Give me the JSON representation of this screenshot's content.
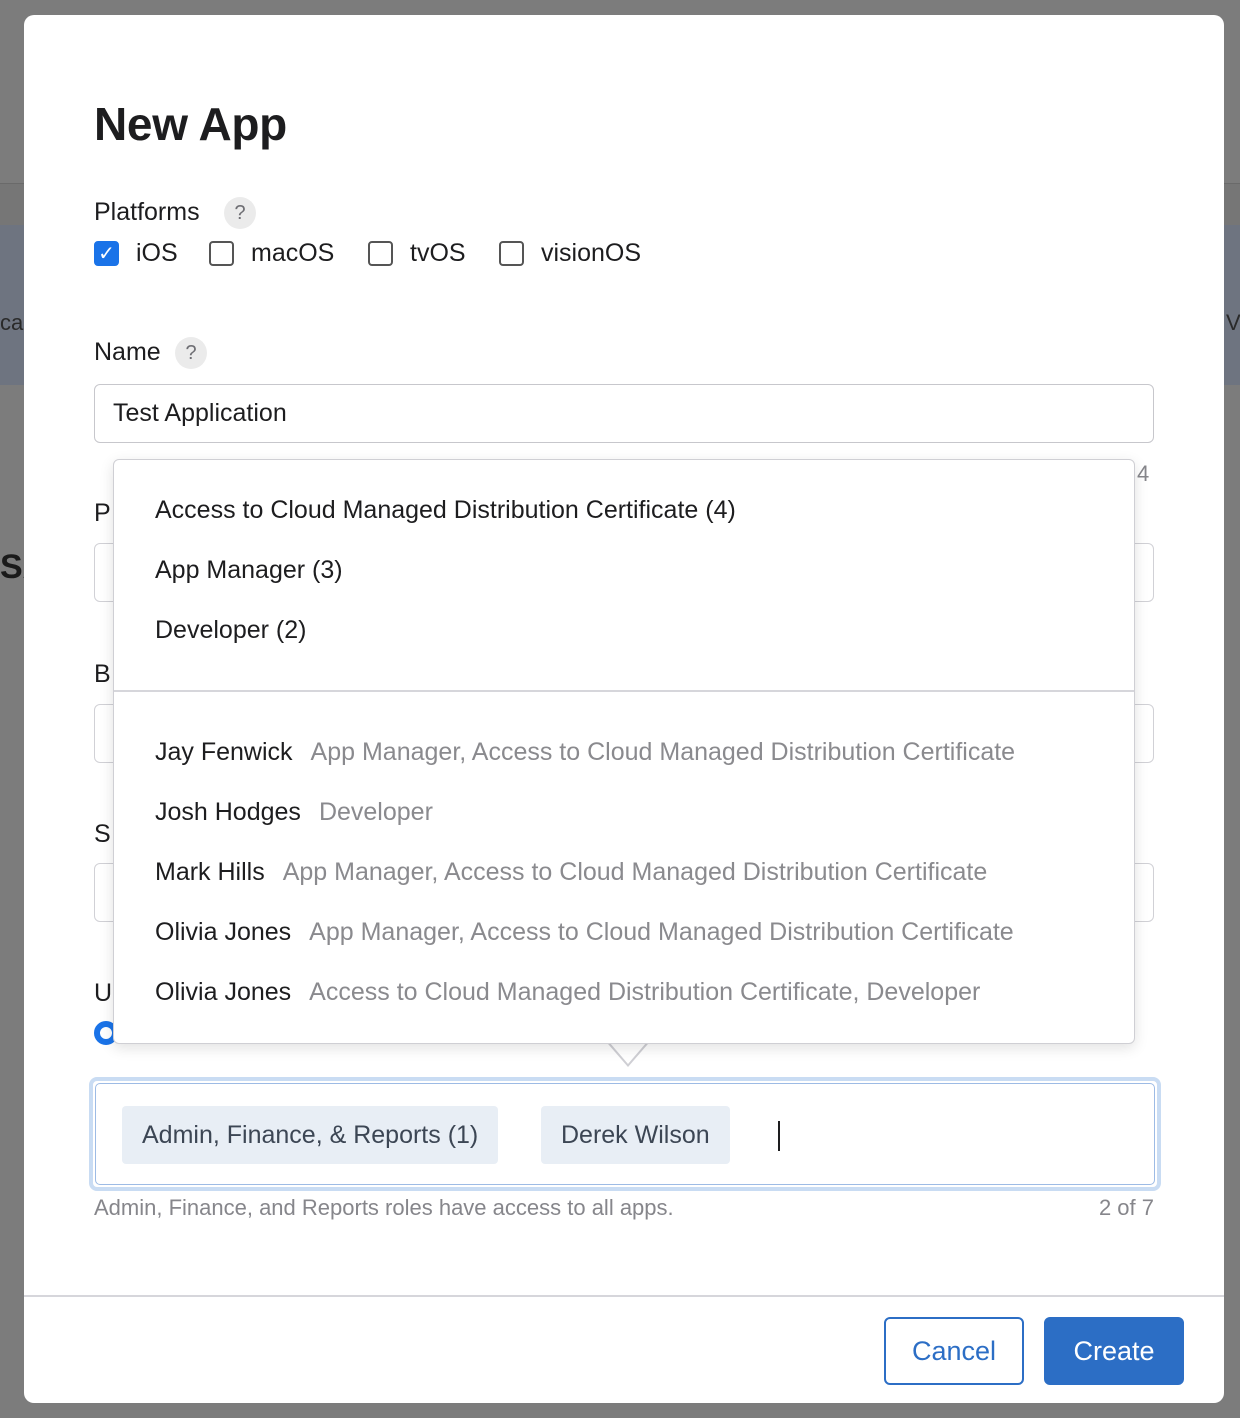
{
  "background": {
    "left_fragment": "ca",
    "right_fragment": "V",
    "left_fragment2": "SA"
  },
  "modal": {
    "title": "New App",
    "platforms": {
      "label": "Platforms",
      "help": "?",
      "options": [
        {
          "label": "iOS",
          "checked": true
        },
        {
          "label": "macOS",
          "checked": false
        },
        {
          "label": "tvOS",
          "checked": false
        },
        {
          "label": "visionOS",
          "checked": false
        }
      ]
    },
    "name": {
      "label": "Name",
      "help": "?",
      "value": "Test Application",
      "char_count": "4"
    },
    "obscured_labels": [
      "P",
      "B",
      "S",
      "U"
    ],
    "access": {
      "tokens": [
        "Admin, Finance, & Reports (1)",
        "Derek Wilson"
      ],
      "hint": "Admin, Finance, and Reports roles have access to all apps.",
      "counter": "2 of 7"
    },
    "dropdown": {
      "groups": [
        "Access to Cloud Managed Distribution Certificate (4)",
        "App Manager (3)",
        "Developer (2)"
      ],
      "people": [
        {
          "name": "Jay Fenwick",
          "roles": "App Manager, Access to Cloud Managed Distribution Certificate"
        },
        {
          "name": "Josh Hodges",
          "roles": "Developer"
        },
        {
          "name": "Mark Hills",
          "roles": "App Manager, Access to Cloud Managed Distribution Certificate"
        },
        {
          "name": "Olivia Jones",
          "roles": "App Manager, Access to Cloud Managed Distribution Certificate"
        },
        {
          "name": "Olivia Jones",
          "roles": "Access to Cloud Managed Distribution Certificate, Developer"
        }
      ]
    },
    "footer": {
      "cancel_label": "Cancel",
      "create_label": "Create"
    },
    "colors": {
      "accent": "#2c6ec5",
      "checkbox_checked": "#1a73e8"
    }
  }
}
